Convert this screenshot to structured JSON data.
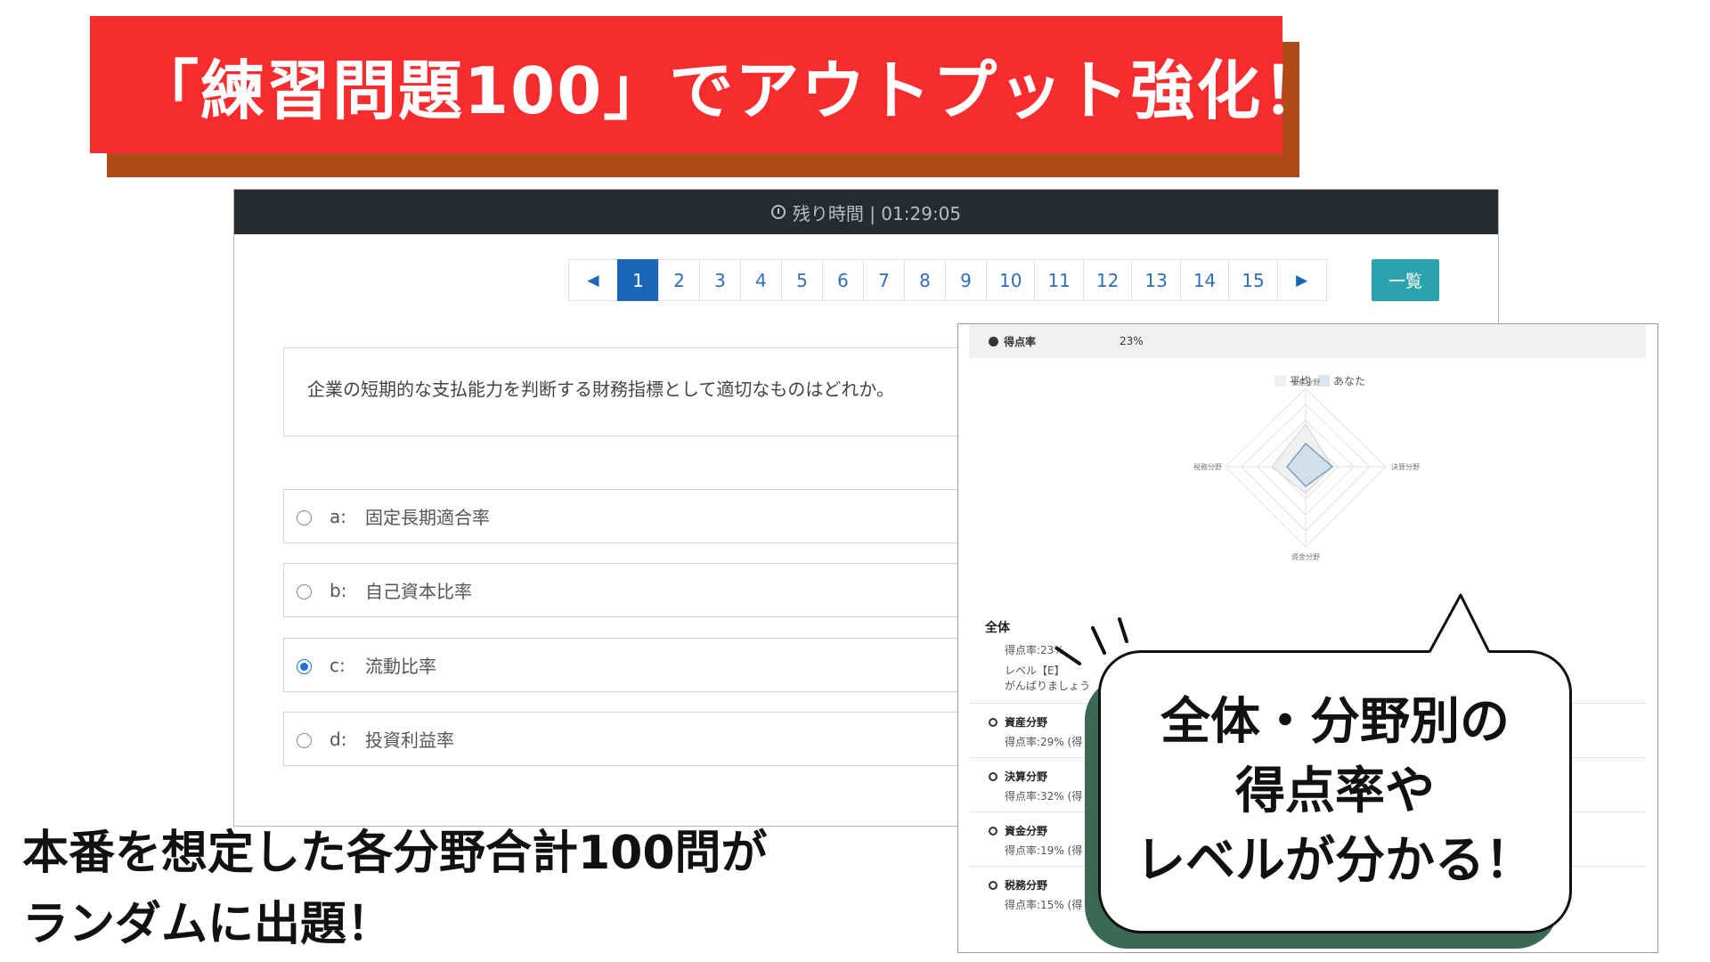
{
  "banner": {
    "title": "「練習問題100」でアウトプット強化！"
  },
  "exam": {
    "timer_label": "残り時間 | 01:29:05",
    "pages": [
      "1",
      "2",
      "3",
      "4",
      "5",
      "6",
      "7",
      "8",
      "9",
      "10",
      "11",
      "12",
      "13",
      "14",
      "15"
    ],
    "active_page": "1",
    "prev_icon": "◀",
    "next_icon": "▶",
    "list_button": "一覧",
    "question": "企業の短期的な支払能力を判断する財務指標として適切なものはどれか。",
    "options": [
      {
        "key": "a:",
        "text": "固定長期適合率",
        "selected": false
      },
      {
        "key": "b:",
        "text": "自己資本比率",
        "selected": false
      },
      {
        "key": "c:",
        "text": "流動比率",
        "selected": true
      },
      {
        "key": "d:",
        "text": "投資利益率",
        "selected": false
      }
    ]
  },
  "score_panel": {
    "rate_label": "得点率",
    "rate_value": "23%",
    "legend": {
      "average": "平均",
      "you": "あなた"
    },
    "radar_axes": {
      "top": "資産分野",
      "right": "決算分野",
      "bottom": "資金分野",
      "left": "税務分野"
    },
    "overall": {
      "title": "全体",
      "rate": "得点率:23%",
      "level": "レベル【E】",
      "message": "がんばりましょう"
    },
    "fields": [
      {
        "title": "資産分野",
        "rate": "得点率:29% (得"
      },
      {
        "title": "決算分野",
        "rate": "得点率:32% (得"
      },
      {
        "title": "資金分野",
        "rate": "得点率:19% (得"
      },
      {
        "title": "税務分野",
        "rate": "得点率:15% (得"
      }
    ]
  },
  "bubble": {
    "line1": "全体・分野別の",
    "line2": "得点率や",
    "line3": "レベルが分かる！"
  },
  "caption": {
    "line1": "本番を想定した各分野合計100問が",
    "line2": "ランダムに出題！"
  },
  "colors": {
    "banner": "#f62c2e",
    "banner_shadow": "#b04a17",
    "accent_blue": "#1c66b8",
    "teal": "#2aa3ac",
    "bubble_shadow": "#3a6a55"
  }
}
